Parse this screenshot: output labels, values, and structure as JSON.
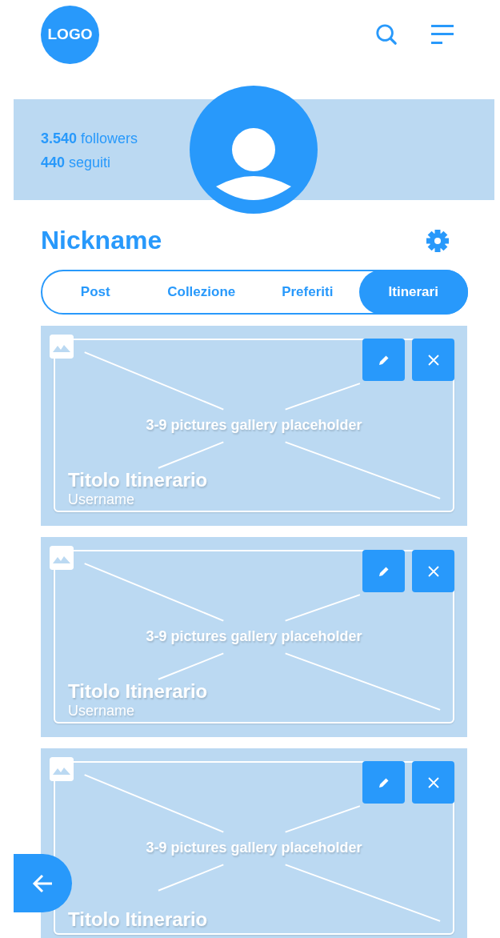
{
  "header": {
    "logo": "LOGO"
  },
  "profile": {
    "stats": [
      "**3.540** followers",
      "**440** seguiti"
    ],
    "nickname": "Nickname"
  },
  "tabs": [
    {
      "label": "Post",
      "selected": false
    },
    {
      "label": "Collezione",
      "selected": false
    },
    {
      "label": "Preferiti",
      "selected": false
    },
    {
      "label": "Itinerari",
      "selected": true
    }
  ],
  "itineraries": [
    {
      "placeholder_text": "3-9 pictures gallery placeholder",
      "title": "Titolo Itinerario",
      "username": "Username"
    },
    {
      "placeholder_text": "3-9 pictures gallery placeholder",
      "title": "Titolo Itinerario",
      "username": "Username"
    },
    {
      "placeholder_text": "3-9 pictures gallery placeholder",
      "title": "Titolo Itinerario"
    }
  ]
}
